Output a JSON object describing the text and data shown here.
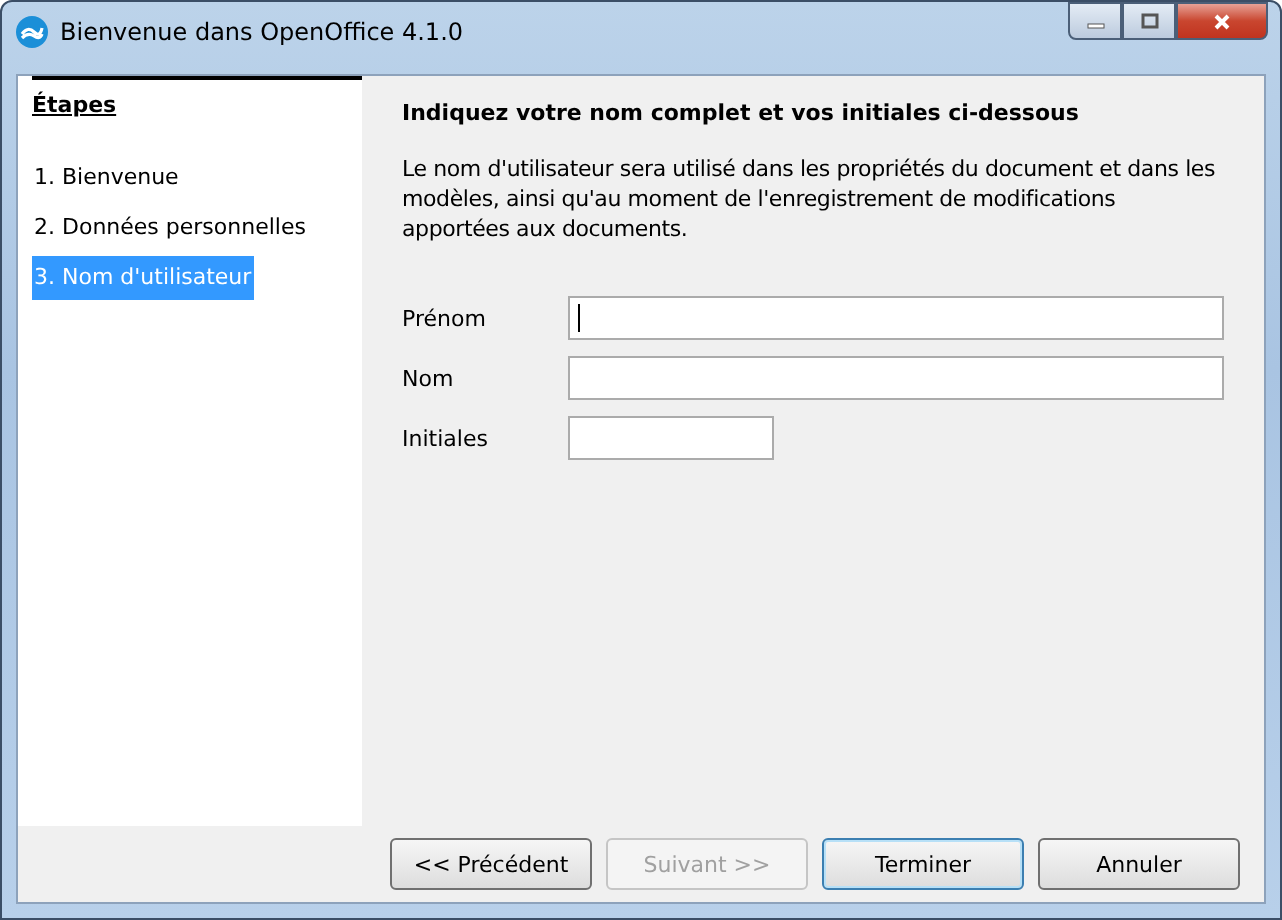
{
  "window": {
    "title": "Bienvenue dans OpenOffice 4.1.0"
  },
  "sidebar": {
    "title": "Étapes",
    "items": [
      {
        "label": "1. Bienvenue",
        "selected": false
      },
      {
        "label": "2. Données personnelles",
        "selected": false
      },
      {
        "label": "3. Nom d'utilisateur",
        "selected": true
      }
    ]
  },
  "content": {
    "heading": "Indiquez votre nom complet et vos initiales ci-dessous",
    "description": "Le nom d'utilisateur sera utilisé dans les propriétés du document et dans les modèles, ainsi qu'au moment de l'enregistrement de modifications apportées aux documents.",
    "fields": [
      {
        "label": "Prénom",
        "kind": "wide",
        "focused": true
      },
      {
        "label": "Nom",
        "kind": "wide",
        "focused": false
      },
      {
        "label": "Initiales",
        "kind": "short",
        "focused": false
      }
    ]
  },
  "buttons": [
    {
      "label": "<< Précédent",
      "disabled": false,
      "default": false
    },
    {
      "label": "Suivant >>",
      "disabled": true,
      "default": false
    },
    {
      "label": "Terminer",
      "disabled": false,
      "default": true
    },
    {
      "label": "Annuler",
      "disabled": false,
      "default": false
    }
  ]
}
